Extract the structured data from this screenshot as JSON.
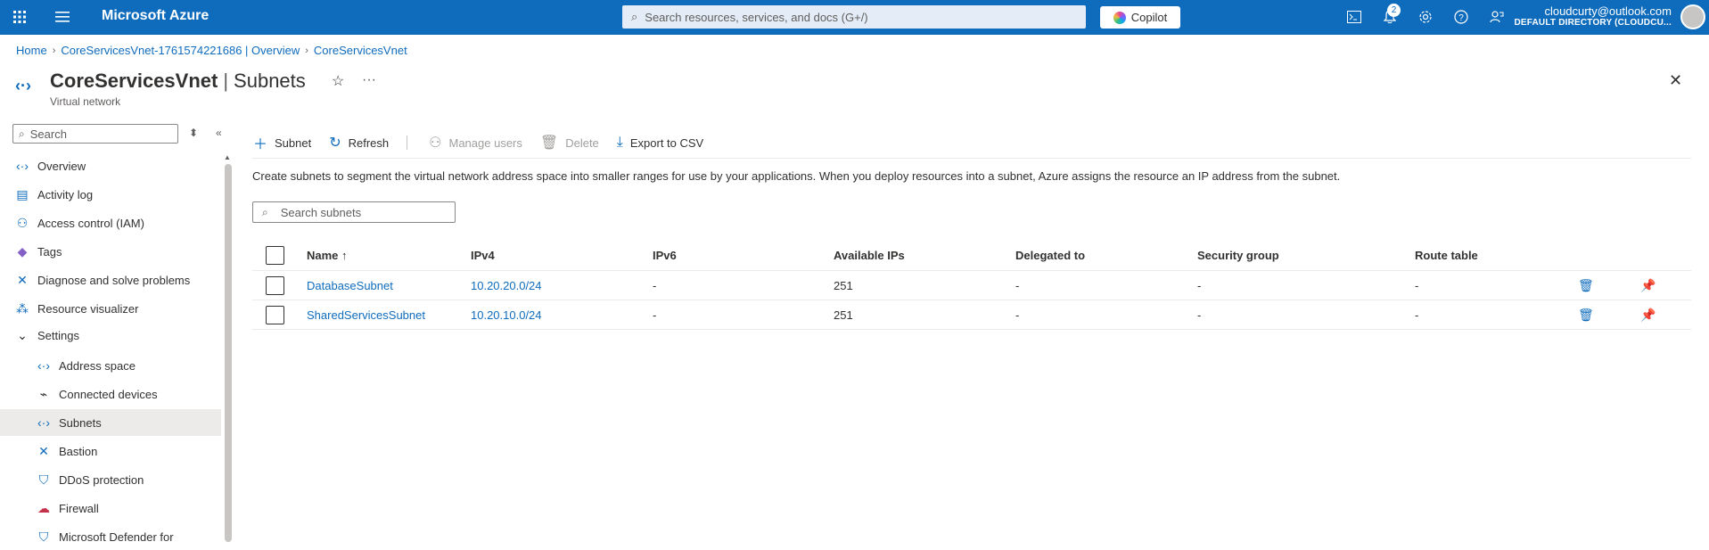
{
  "topbar": {
    "brand": "Microsoft Azure",
    "search_placeholder": "Search resources, services, and docs (G+/)",
    "copilot_label": "Copilot",
    "notification_count": "2",
    "user_email": "cloudcurty@outlook.com",
    "user_directory": "DEFAULT DIRECTORY (CLOUDCU..."
  },
  "breadcrumb": [
    "Home",
    "CoreServicesVnet-1761574221686 | Overview",
    "CoreServicesVnet"
  ],
  "header": {
    "resource_name": "CoreServicesVnet",
    "separator": "|",
    "page_name": "Subnets",
    "subtitle": "Virtual network"
  },
  "sidebar": {
    "search_placeholder": "Search",
    "items": [
      {
        "label": "Overview",
        "icon": "vnet-icon"
      },
      {
        "label": "Activity log",
        "icon": "activity-log-icon"
      },
      {
        "label": "Access control (IAM)",
        "icon": "iam-icon"
      },
      {
        "label": "Tags",
        "icon": "tag-icon"
      },
      {
        "label": "Diagnose and solve problems",
        "icon": "diagnose-icon"
      },
      {
        "label": "Resource visualizer",
        "icon": "visualizer-icon"
      },
      {
        "label": "Settings",
        "icon": "chevron-down-icon"
      },
      {
        "label": "Address space",
        "icon": "vnet-icon"
      },
      {
        "label": "Connected devices",
        "icon": "plug-icon"
      },
      {
        "label": "Subnets",
        "icon": "vnet-icon"
      },
      {
        "label": "Bastion",
        "icon": "bastion-icon"
      },
      {
        "label": "DDoS protection",
        "icon": "shield-icon"
      },
      {
        "label": "Firewall",
        "icon": "firewall-icon"
      },
      {
        "label": "Microsoft Defender for",
        "icon": "defender-icon"
      }
    ]
  },
  "toolbar": {
    "subnet": "Subnet",
    "refresh": "Refresh",
    "manage_users": "Manage users",
    "delete": "Delete",
    "export_csv": "Export to CSV"
  },
  "description": "Create subnets to segment the virtual network address space into smaller ranges for use by your applications. When you deploy resources into a subnet, Azure assigns the resource an IP address from the subnet.",
  "subnet_search_placeholder": "Search subnets",
  "table": {
    "columns": [
      "Name ↑",
      "IPv4",
      "IPv6",
      "Available IPs",
      "Delegated to",
      "Security group",
      "Route table"
    ],
    "rows": [
      {
        "name": "DatabaseSubnet",
        "ipv4": "10.20.20.0/24",
        "ipv6": "-",
        "available": "251",
        "delegated": "-",
        "nsg": "-",
        "route": "-"
      },
      {
        "name": "SharedServicesSubnet",
        "ipv4": "10.20.10.0/24",
        "ipv6": "-",
        "available": "251",
        "delegated": "-",
        "nsg": "-",
        "route": "-"
      }
    ]
  },
  "colors": {
    "accent": "#0f6cbd",
    "topbar": "#0f6cbd",
    "selected_nav": "#edebe9"
  }
}
